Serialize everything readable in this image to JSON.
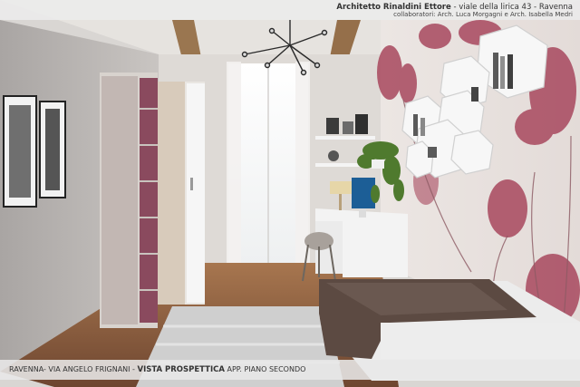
{
  "header": {
    "architect": "Architetto Rinaldini Ettore",
    "address": "- viale della lirica 43 - Ravenna",
    "collaborators": "collaboratori: Arch. Luca Morgagni e Arch. Isabella Medri"
  },
  "footer": {
    "location": "RAVENNA- VIA ANGELO FRIGNANI -",
    "view_title": "VISTA PROSPETTICA",
    "floor": "APP. PIANO SECONDO"
  },
  "colors": {
    "wall_left": "#bdb9b6",
    "wall_back": "#dedad6",
    "ceiling": "#e6e3df",
    "beam": "#9a7650",
    "floor": "#8a5e3e",
    "wardrobe_plum": "#8a4a5e",
    "mural_flower": "#a8485e",
    "bed": "#5c4a42"
  }
}
